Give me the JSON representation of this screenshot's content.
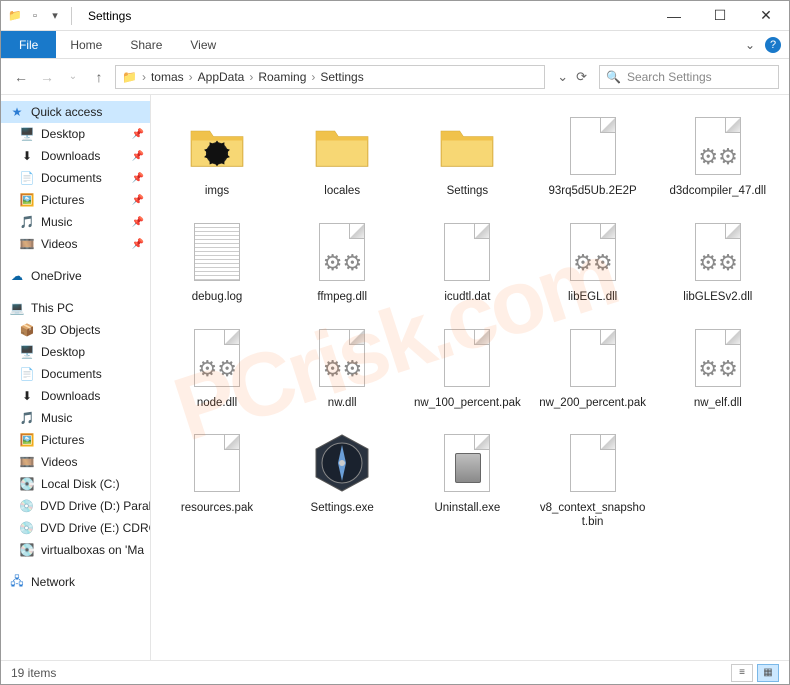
{
  "window": {
    "title": "Settings"
  },
  "ribbon": {
    "file": "File",
    "tabs": [
      "Home",
      "Share",
      "View"
    ]
  },
  "breadcrumbs": [
    "tomas",
    "AppData",
    "Roaming",
    "Settings"
  ],
  "search": {
    "placeholder": "Search Settings"
  },
  "nav": {
    "quick_access": "Quick access",
    "quick_items": [
      {
        "label": "Desktop",
        "icon": "🖥️",
        "pinned": true
      },
      {
        "label": "Downloads",
        "icon": "⬇",
        "pinned": true
      },
      {
        "label": "Documents",
        "icon": "📄",
        "pinned": true
      },
      {
        "label": "Pictures",
        "icon": "🖼️",
        "pinned": true
      },
      {
        "label": "Music",
        "icon": "🎵",
        "pinned": true
      },
      {
        "label": "Videos",
        "icon": "🎞️",
        "pinned": true
      }
    ],
    "onedrive": "OneDrive",
    "this_pc": "This PC",
    "pc_items": [
      {
        "label": "3D Objects",
        "icon": "📦"
      },
      {
        "label": "Desktop",
        "icon": "🖥️"
      },
      {
        "label": "Documents",
        "icon": "📄"
      },
      {
        "label": "Downloads",
        "icon": "⬇"
      },
      {
        "label": "Music",
        "icon": "🎵"
      },
      {
        "label": "Pictures",
        "icon": "🖼️"
      },
      {
        "label": "Videos",
        "icon": "🎞️"
      },
      {
        "label": "Local Disk (C:)",
        "icon": "💽"
      },
      {
        "label": "DVD Drive (D:) Paral",
        "icon": "💿"
      },
      {
        "label": "DVD Drive (E:) CDRO",
        "icon": "💿"
      },
      {
        "label": "virtualboxas on 'Ma",
        "icon": "💽"
      }
    ],
    "network": "Network"
  },
  "files": [
    {
      "name": "imgs",
      "type": "folder-gear"
    },
    {
      "name": "locales",
      "type": "folder"
    },
    {
      "name": "Settings",
      "type": "folder"
    },
    {
      "name": "93rq5d5Ub.2E2P",
      "type": "file"
    },
    {
      "name": "d3dcompiler_47.dll",
      "type": "dll"
    },
    {
      "name": "debug.log",
      "type": "log"
    },
    {
      "name": "ffmpeg.dll",
      "type": "dll"
    },
    {
      "name": "icudtl.dat",
      "type": "file"
    },
    {
      "name": "libEGL.dll",
      "type": "dll"
    },
    {
      "name": "libGLESv2.dll",
      "type": "dll"
    },
    {
      "name": "node.dll",
      "type": "dll"
    },
    {
      "name": "nw.dll",
      "type": "dll"
    },
    {
      "name": "nw_100_percent.pak",
      "type": "file"
    },
    {
      "name": "nw_200_percent.pak",
      "type": "file"
    },
    {
      "name": "nw_elf.dll",
      "type": "dll"
    },
    {
      "name": "resources.pak",
      "type": "file"
    },
    {
      "name": "Settings.exe",
      "type": "compass"
    },
    {
      "name": "Uninstall.exe",
      "type": "uninstall"
    },
    {
      "name": "v8_context_snapshot.bin",
      "type": "file"
    }
  ],
  "status": {
    "items": "19 items"
  },
  "watermark": "PCrisk.com"
}
